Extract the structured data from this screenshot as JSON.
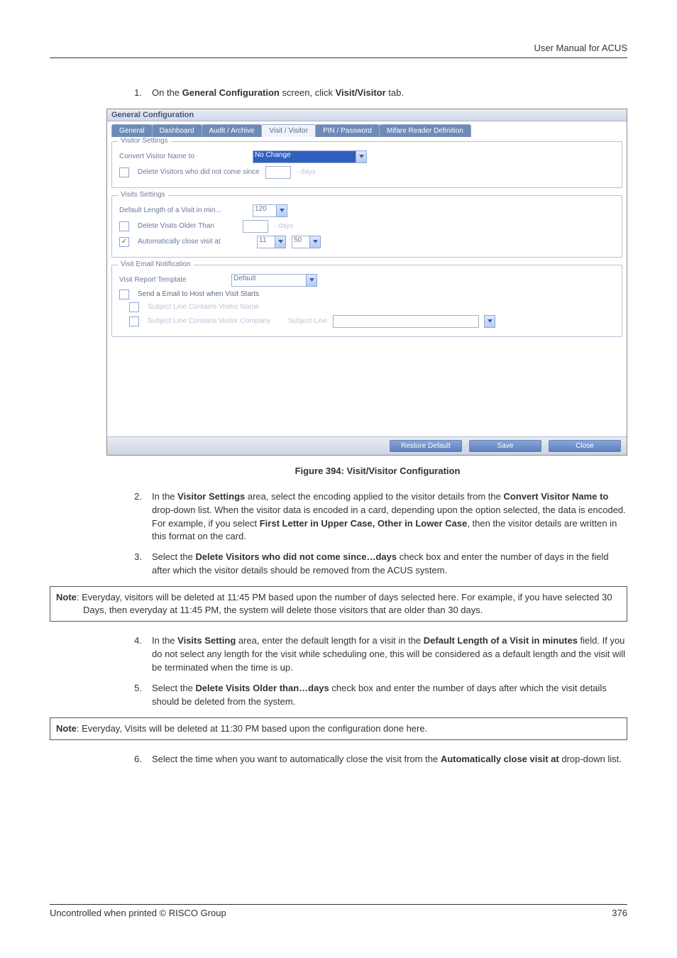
{
  "doc": {
    "header": "User Manual for ACUS",
    "footer_left": "Uncontrolled when printed © RISCO Group",
    "footer_right": "376",
    "figure_caption": "Figure 394: Visit/Visitor Configuration"
  },
  "steps": {
    "s1_num": "1.",
    "s1_a": "On the ",
    "s1_b": "General Configuration",
    "s1_c": " screen, click ",
    "s1_d": "Visit/Visitor",
    "s1_e": " tab.",
    "s2_num": "2.",
    "s2_a": "In the ",
    "s2_b": "Visitor Settings",
    "s2_c": " area, select the encoding applied to the visitor details from the ",
    "s2_d": "Convert Visitor Name to",
    "s2_e": " drop-down list. When the visitor data is encoded in a card, depending upon the option selected, the data is encoded. For example, if you select ",
    "s2_f": "First Letter in Upper Case, Other in Lower Case",
    "s2_g": ", then the visitor details are written in this format on the card.",
    "s3_num": "3.",
    "s3_a": "Select the ",
    "s3_b": "Delete Visitors who did not come since…days",
    "s3_c": " check box and enter the number of days in the field after which the visitor details should be removed from the ACUS system.",
    "s4_num": "4.",
    "s4_a": "In the ",
    "s4_b": "Visits Setting",
    "s4_c": " area, enter the default length for a visit in the ",
    "s4_d": "Default Length of a Visit in minutes",
    "s4_e": " field. If you do not select any length for the visit while scheduling one, this will be considered as a default length and the visit will be terminated when the time is up.",
    "s5_num": "5.",
    "s5_a": "Select the ",
    "s5_b": "Delete Visits Older than…days",
    "s5_c": " check box and enter the number of days after which the visit details should be deleted from the system.",
    "s6_num": "6.",
    "s6_a": "Select the time when you want to automatically close the visit from the ",
    "s6_b": "Automatically close visit at",
    "s6_c": " drop-down list."
  },
  "notes": {
    "n1_label": "Note",
    "n1_body": ": Everyday, visitors will be deleted at 11:45 PM based upon the number of days selected here. For example, if you have selected 30 Days, then everyday at 11:45 PM, the system will delete those visitors that are older than 30 days.",
    "n2_label": "Note",
    "n2_body": ": Everyday, Visits will be deleted at 11:30 PM based upon the configuration done here."
  },
  "ui": {
    "window_title": "General Configuration",
    "tabs": {
      "general": "General",
      "dashboard": "Dashboard",
      "audit": "Audit / Archive",
      "visit": "Visit / Visitor",
      "pin": "PIN / Password",
      "mifare": "Mifare Reader Definition"
    },
    "visitor_settings": {
      "legend": "Visitor Settings",
      "convert_label": "Convert Visitor Name to",
      "convert_value": "No Change",
      "delete_label": "Delete Visitors who did not come since",
      "delete_days_value": "",
      "delete_days_suffix": "  -  days"
    },
    "visits_settings": {
      "legend": "Visits Settings",
      "length_label": "Default Length of a Visit in min...",
      "length_value": "120",
      "delete_older_label": "Delete Visits Older Than",
      "delete_older_value": "",
      "delete_older_suffix": "  -  days",
      "auto_close_label": "Automatically close visit at",
      "auto_close_hour": "11",
      "auto_close_min": "50"
    },
    "email": {
      "legend": "Visit Email Notification",
      "template_label": "Visit Report Template",
      "template_value": "Default",
      "send_label": "Send a Email to Host when Visit Starts",
      "contains_name_label": "Subject Line Contains Visitor Name",
      "contains_company_label": "Subject Line Contains Visitor Company",
      "subject_line_label": "Subject Line"
    },
    "buttons": {
      "restore": "Restore Default",
      "save": "Save",
      "close": "Close"
    }
  }
}
